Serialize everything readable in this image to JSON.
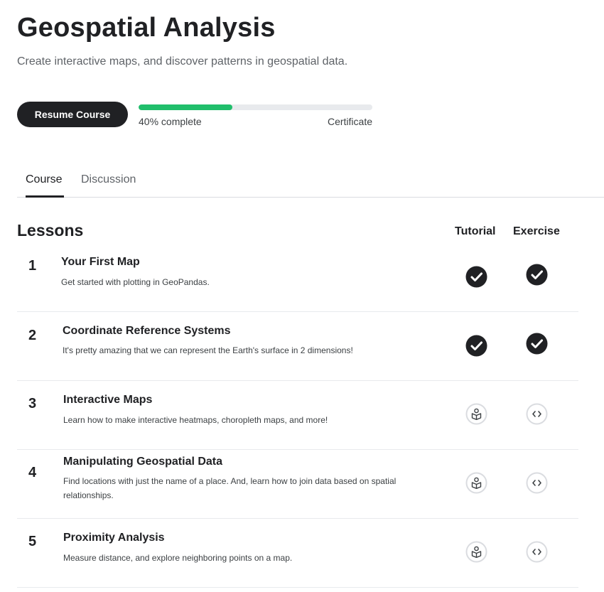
{
  "header": {
    "title": "Geospatial Analysis",
    "subtitle": "Create interactive maps, and discover patterns in geospatial data."
  },
  "resume_button": {
    "label": "Resume Course"
  },
  "progress": {
    "percent": 40,
    "complete_label": "40% complete",
    "certificate_label": "Certificate"
  },
  "tabs": [
    {
      "label": "Course",
      "active": true
    },
    {
      "label": "Discussion",
      "active": false
    }
  ],
  "lessons_section": {
    "heading": "Lessons",
    "tutorial_header": "Tutorial",
    "exercise_header": "Exercise"
  },
  "lessons": [
    {
      "number": "1",
      "title": "Your First Map",
      "description": "Get started with plotting in GeoPandas.",
      "tutorial_status": "completed",
      "exercise_status": "completed"
    },
    {
      "number": "2",
      "title": "Coordinate Reference Systems",
      "description": "It's pretty amazing that we can represent the Earth's surface in 2 dimensions!",
      "tutorial_status": "completed",
      "exercise_status": "completed"
    },
    {
      "number": "3",
      "title": "Interactive Maps",
      "description": "Learn how to make interactive heatmaps, choropleth maps, and more!",
      "tutorial_status": "not-started",
      "exercise_status": "not-started"
    },
    {
      "number": "4",
      "title": "Manipulating Geospatial Data",
      "description": "Find locations with just the name of a place. And, learn how to join data based on spatial relationships.",
      "tutorial_status": "not-started",
      "exercise_status": "not-started"
    },
    {
      "number": "5",
      "title": "Proximity Analysis",
      "description": "Measure distance, and explore neighboring points on a map.",
      "tutorial_status": "not-started",
      "exercise_status": "not-started"
    }
  ],
  "icons": {
    "completed": "check-circle-icon",
    "tutorial": "book-reader-icon",
    "exercise": "code-brackets-icon"
  },
  "colors": {
    "progress_fill": "#20be6b",
    "primary_dark": "#202124"
  }
}
